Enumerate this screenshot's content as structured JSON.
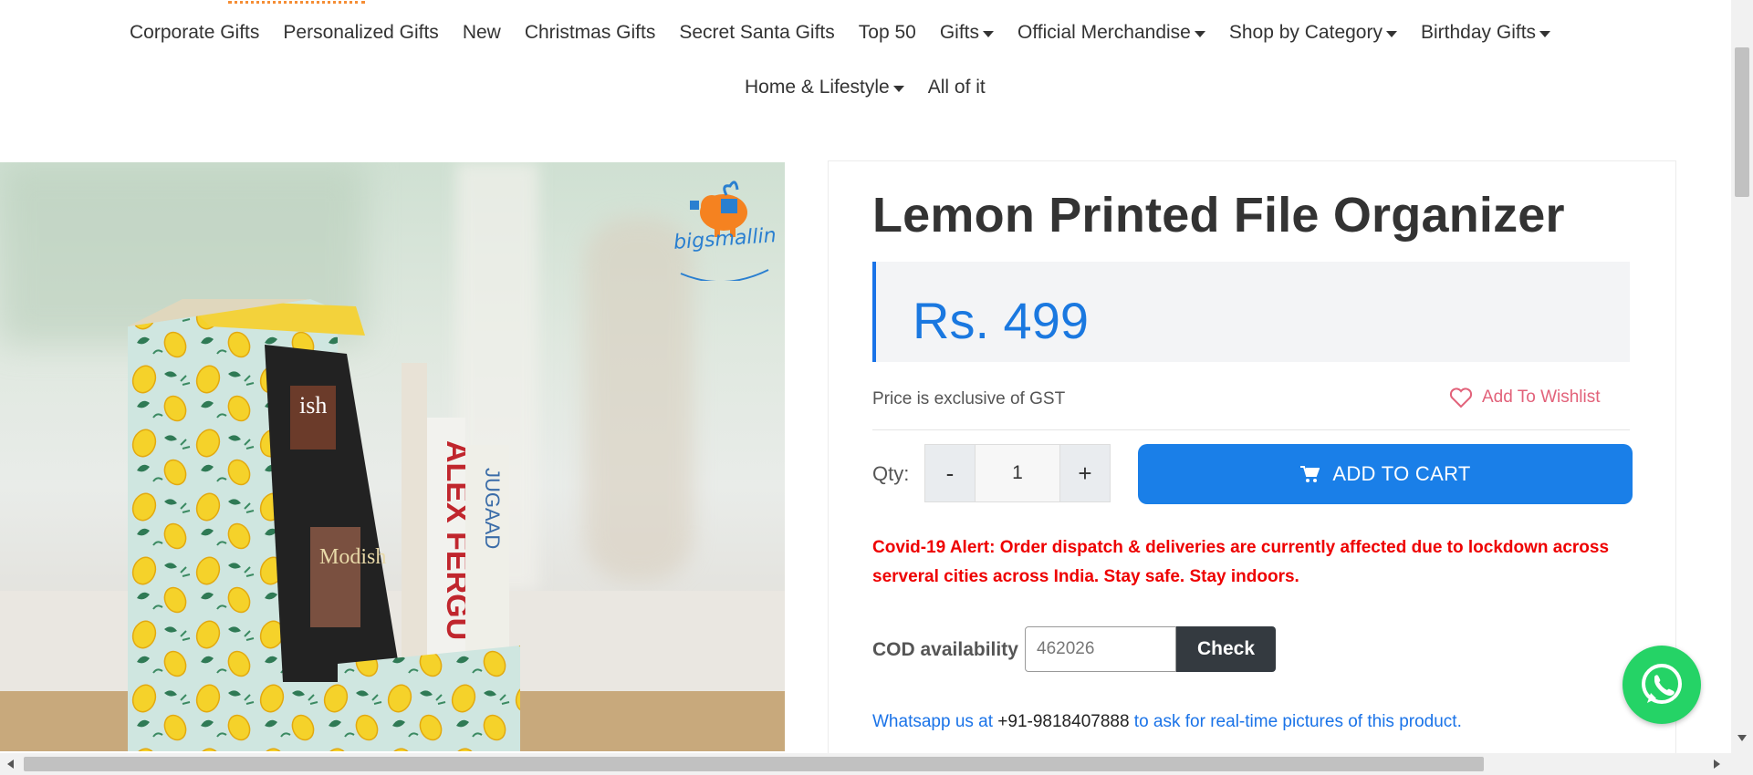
{
  "nav": {
    "row1": [
      {
        "label": "Corporate Gifts",
        "dropdown": false
      },
      {
        "label": "Personalized Gifts",
        "dropdown": false
      },
      {
        "label": "New",
        "dropdown": false
      },
      {
        "label": "Christmas Gifts",
        "dropdown": false
      },
      {
        "label": "Secret Santa Gifts",
        "dropdown": false
      },
      {
        "label": "Top 50",
        "dropdown": false
      },
      {
        "label": "Gifts",
        "dropdown": true
      },
      {
        "label": "Official Merchandise",
        "dropdown": true
      },
      {
        "label": "Shop by Category",
        "dropdown": true
      },
      {
        "label": "Birthday Gifts",
        "dropdown": true
      }
    ],
    "row2": [
      {
        "label": "Home & Lifestyle",
        "dropdown": true
      },
      {
        "label": "All of it",
        "dropdown": false
      }
    ]
  },
  "product": {
    "title": "Lemon Printed File Organizer",
    "price": "Rs. 499",
    "gst_note": "Price is exclusive of GST",
    "wishlist_label": "Add To Wishlist",
    "qty_label": "Qty:",
    "qty_minus": "-",
    "qty_value": "1",
    "qty_plus": "+",
    "add_to_cart_label": "ADD TO CART",
    "covid_alert": "Covid-19 Alert: Order dispatch & deliveries are currently affected due to lockdown across serveral cities across India. Stay safe. Stay indoors.",
    "cod_label": "COD availability",
    "cod_pincode": "462026",
    "cod_check_label": "Check",
    "whatsapp_prefix": "Whatsapp us at ",
    "whatsapp_phone": "+91-9818407888",
    "whatsapp_suffix": " to ask for real-time pictures of this product."
  },
  "image": {
    "brand_logo_text": "bigsmallin"
  },
  "colors": {
    "accent_blue": "#1a7fe8",
    "alert_red": "#e00000",
    "wishlist_pink": "#e2627a",
    "whatsapp_green": "#25d366"
  }
}
